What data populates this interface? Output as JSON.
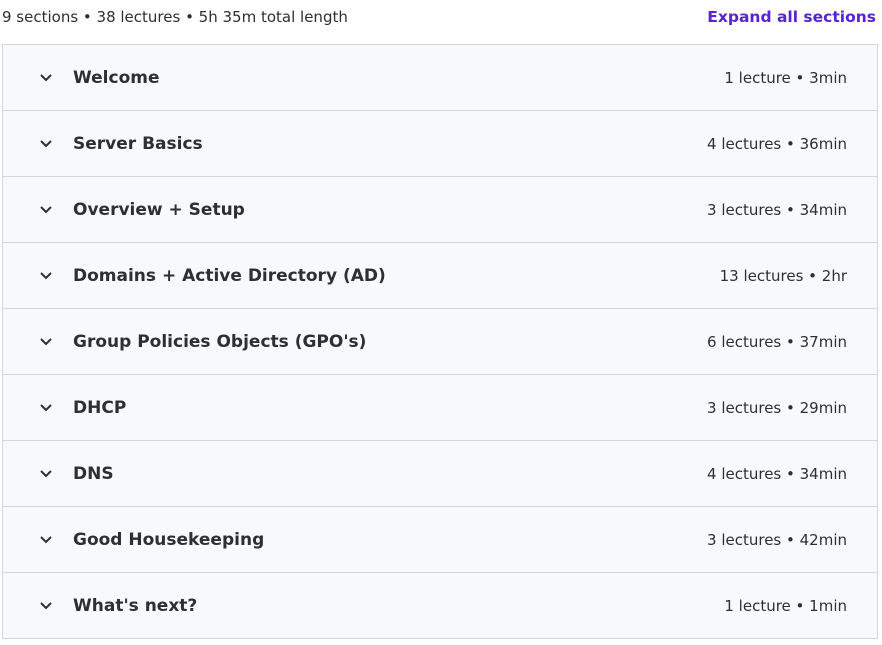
{
  "summary": {
    "text": "9 sections • 38 lectures • 5h 35m total length",
    "expand_label": "Expand all sections"
  },
  "colors": {
    "link": "#5624d0",
    "row_bg": "#f7f9fa",
    "border": "#d1d7dc",
    "text": "#2d2f31"
  },
  "sections": [
    {
      "title": "Welcome",
      "meta": "1 lecture • 3min",
      "icon": "chevron-down-icon"
    },
    {
      "title": "Server Basics",
      "meta": "4 lectures • 36min",
      "icon": "chevron-down-icon"
    },
    {
      "title": "Overview + Setup",
      "meta": "3 lectures • 34min",
      "icon": "chevron-down-icon"
    },
    {
      "title": "Domains + Active Directory (AD)",
      "meta": "13 lectures • 2hr",
      "icon": "chevron-down-icon"
    },
    {
      "title": "Group Policies Objects (GPO's)",
      "meta": "6 lectures • 37min",
      "icon": "chevron-down-icon"
    },
    {
      "title": "DHCP",
      "meta": "3 lectures • 29min",
      "icon": "chevron-down-icon"
    },
    {
      "title": "DNS",
      "meta": "4 lectures • 34min",
      "icon": "chevron-down-icon"
    },
    {
      "title": "Good Housekeeping",
      "meta": "3 lectures • 42min",
      "icon": "chevron-down-icon"
    },
    {
      "title": "What's next?",
      "meta": "1 lecture • 1min",
      "icon": "chevron-down-icon"
    }
  ]
}
